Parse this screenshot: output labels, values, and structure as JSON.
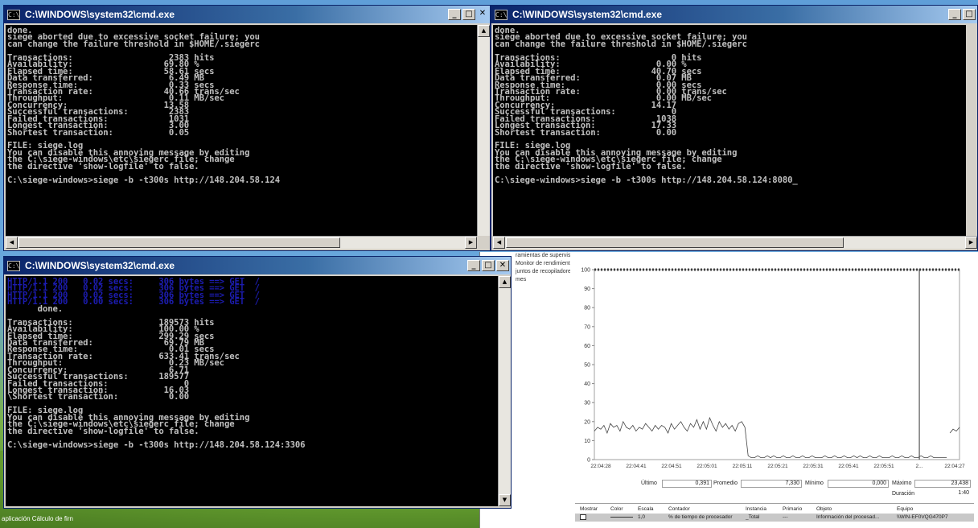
{
  "windows": [
    {
      "title": "C:\\WINDOWS\\system32\\cmd.exe",
      "lines": [
        "done.",
        "siege aborted due to excessive socket failure; you",
        "can change the failure threshold in $HOME/.siegerc",
        "",
        "Transactions:                   2383 hits",
        "Availability:                  69.80 %",
        "Elapsed time:                  58.61 secs",
        "Data transferred:               6.49 MB",
        "Response time:                  0.33 secs",
        "Transaction rate:              40.66 trans/sec",
        "Throughput:                     0.11 MB/sec",
        "Concurrency:                   13.58",
        "Successful transactions:        2383",
        "Failed transactions:            1031",
        "Longest transaction:            3.00",
        "Shortest transaction:           0.05",
        "",
        "FILE: siege.log",
        "You can disable this annoying message by editing",
        "the C:\\siege-windows\\etc\\siegerc file; change",
        "the directive 'show-logfile' to false.",
        "",
        "C:\\siege-windows>siege -b -t300s http://148.204.58.124"
      ]
    },
    {
      "title": "C:\\WINDOWS\\system32\\cmd.exe",
      "lines": [
        "done.",
        "siege aborted due to excessive socket failure; you",
        "can change the failure threshold in $HOME/.siegerc",
        "",
        "Transactions:                      0 hits",
        "Availability:                   0.00 %",
        "Elapsed time:                  40.70 secs",
        "Data transferred:               0.07 MB",
        "Response time:                  0.00 secs",
        "Transaction rate:               0.00 trans/sec",
        "Throughput:                     0.00 MB/sec",
        "Concurrency:                   14.17",
        "Successful transactions:           0",
        "Failed transactions:            1038",
        "Longest transaction:           17.33",
        "Shortest transaction:           0.00",
        "",
        "FILE: siege.log",
        "You can disable this annoying message by editing",
        "the C:\\siege-windows\\etc\\siegerc file; change",
        "the directive 'show-logfile' to false.",
        "",
        "C:\\siege-windows>siege -b -t300s http://148.204.58.124:8080_"
      ]
    },
    {
      "title": "C:\\WINDOWS\\system32\\cmd.exe",
      "dim_lines": [
        "HTTP/1.1 200   0.02 secs:     306 bytes ==> GET  /",
        "HTTP/1.1 200   0.02 secs:     306 bytes ==> GET  /",
        "HTTP/1.1 200   0.02 secs:     306 bytes ==> GET  /",
        "HTTP/1.1 200   0.00 secs:     306 bytes ==> GET  /"
      ],
      "lines": [
        "      done.",
        "",
        "Transactions:                 189573 hits",
        "Availability:                 100.00 %",
        "Elapsed time:                 299.29 secs",
        "Data transferred:              69.79 MB",
        "Response time:                  0.01 secs",
        "Transaction rate:             633.41 trans/sec",
        "Throughput:                     0.23 MB/sec",
        "Concurrency:                    6.71",
        "Successful transactions:      189577",
        "Failed transactions:               0",
        "Longest transaction:           16.03",
        "\\Shortest transaction:          0.00",
        "",
        "FILE: siege.log",
        "You can disable this annoying message by editing",
        "the C:\\siege-windows\\etc\\siegerc file; change",
        "the directive 'show-logfile' to false.",
        "",
        "C:\\siege-windows>siege -b -t300s http://148.204.58.124:3306"
      ]
    }
  ],
  "perf": {
    "tree_items": [
      "ramientas de supervisió",
      "Monitor de rendimiento",
      "juntos de recopiladore",
      "mes"
    ],
    "chart_data": {
      "type": "line",
      "ylim": [
        0,
        100
      ],
      "y_ticks": [
        "100",
        "90",
        "80",
        "70",
        "60",
        "50",
        "40",
        "30",
        "20",
        "10",
        "0"
      ],
      "x_ticks": [
        "22:04:28",
        "22:04:41",
        "22:04:51",
        "22:05:01",
        "22:05:11",
        "22:05:21",
        "22:05:31",
        "22:05:41",
        "22:05:51",
        "2...",
        "22:04:27"
      ],
      "series": [
        {
          "values": [
            15,
            17,
            16,
            18,
            14,
            19,
            17,
            18,
            15,
            20,
            17,
            16,
            18,
            15,
            17,
            16,
            19,
            17,
            15,
            18,
            16,
            18,
            17,
            14,
            19,
            16,
            18,
            20,
            17,
            15,
            19,
            17,
            21,
            16,
            20,
            16,
            22,
            18,
            15,
            20,
            17,
            19,
            16,
            18,
            15,
            19,
            20,
            17,
            2,
            1,
            1,
            2,
            1,
            1,
            2,
            1,
            2,
            1,
            1,
            2,
            1,
            1,
            2,
            1,
            1,
            2,
            1,
            1,
            2,
            1,
            1,
            1,
            2,
            1,
            1,
            2,
            1,
            1,
            2,
            1,
            1,
            2,
            1,
            2,
            1,
            1,
            2,
            1,
            1,
            2,
            1,
            1,
            1,
            2,
            1,
            1,
            2,
            1,
            1,
            2,
            1,
            1,
            2,
            1,
            1,
            2,
            1,
            1,
            1,
            1,
            1,
            14,
            16,
            15,
            17
          ]
        }
      ]
    },
    "stats": {
      "ultimo_label": "Último",
      "ultimo_value": "0,391",
      "promedio_label": "Promedio",
      "promedio_value": "7,330",
      "minimo_label": "Mínimo",
      "minimo_value": "0,000",
      "maximo_label": "Máximo",
      "maximo_value": "23,438",
      "duracion_label": "Duración",
      "duracion_value": "1:40"
    },
    "legend": {
      "headers": [
        "Mostrar",
        "Color",
        "Escala",
        "Contador",
        "Instancia",
        "Primario",
        "Objeto",
        "Equipo"
      ],
      "row": [
        "1,0",
        "% de tiempo de procesador",
        "_Total",
        "---",
        "Información del procesad...",
        "\\\\WIN-EF0VQG470P7"
      ]
    }
  },
  "taskbar_text": "aplicación      Cálculo de firn"
}
